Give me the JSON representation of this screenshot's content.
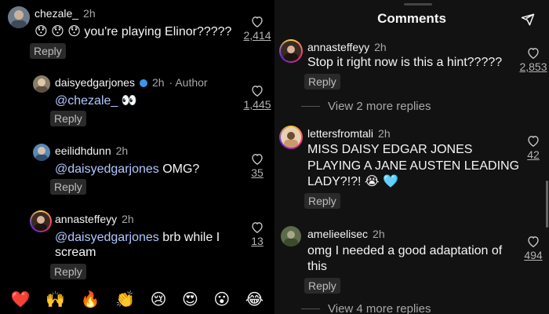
{
  "left": {
    "comments": [
      {
        "user": "chezale_",
        "time": "2h",
        "text": "😯 😯 😯 you're playing Elinor?????",
        "likes": "2,414",
        "reply": "Reply"
      },
      {
        "user": "daisyedgarjones",
        "time": "2h",
        "author_label": "· Author",
        "mention": "@chezale_",
        "text_after": " 👀",
        "likes": "1,445",
        "reply": "Reply"
      },
      {
        "user": "eeilidhdunn",
        "time": "2h",
        "mention": "@daisyedgarjones",
        "text_after": " OMG?",
        "likes": "35",
        "reply": "Reply"
      },
      {
        "user": "annasteffeyy",
        "time": "2h",
        "mention": "@daisyedgarjones",
        "text_after": " brb while I",
        "text_line2": "scream",
        "likes": "13",
        "reply": "Reply"
      }
    ],
    "emoji_bar": [
      "❤️",
      "🙌",
      "🔥",
      "👏",
      "😢",
      "😍",
      "😮",
      "😂"
    ]
  },
  "right": {
    "title": "Comments",
    "comments": [
      {
        "user": "annasteffeyy",
        "time": "2h",
        "text": "Stop it right now is this a hint?????",
        "likes": "2,853",
        "reply": "Reply"
      },
      {
        "user": "lettersfromtali",
        "time": "2h",
        "text_lines": [
          "MISS DAISY EDGAR JONES",
          "PLAYING A JANE AUSTEN LEADING",
          "LADY?!?! 😭 🩵"
        ],
        "likes": "42",
        "reply": "Reply"
      },
      {
        "user": "amelieelisec",
        "time": "2h",
        "text_lines": [
          "omg I needed a good adaptation of",
          "this"
        ],
        "likes": "494",
        "reply": "Reply"
      }
    ],
    "view_more_1": "View 2 more replies",
    "view_more_2": "View 4 more replies"
  },
  "colors": {
    "background": "#000000",
    "mention": "#b3c7ff",
    "verified": "#3897f0"
  }
}
